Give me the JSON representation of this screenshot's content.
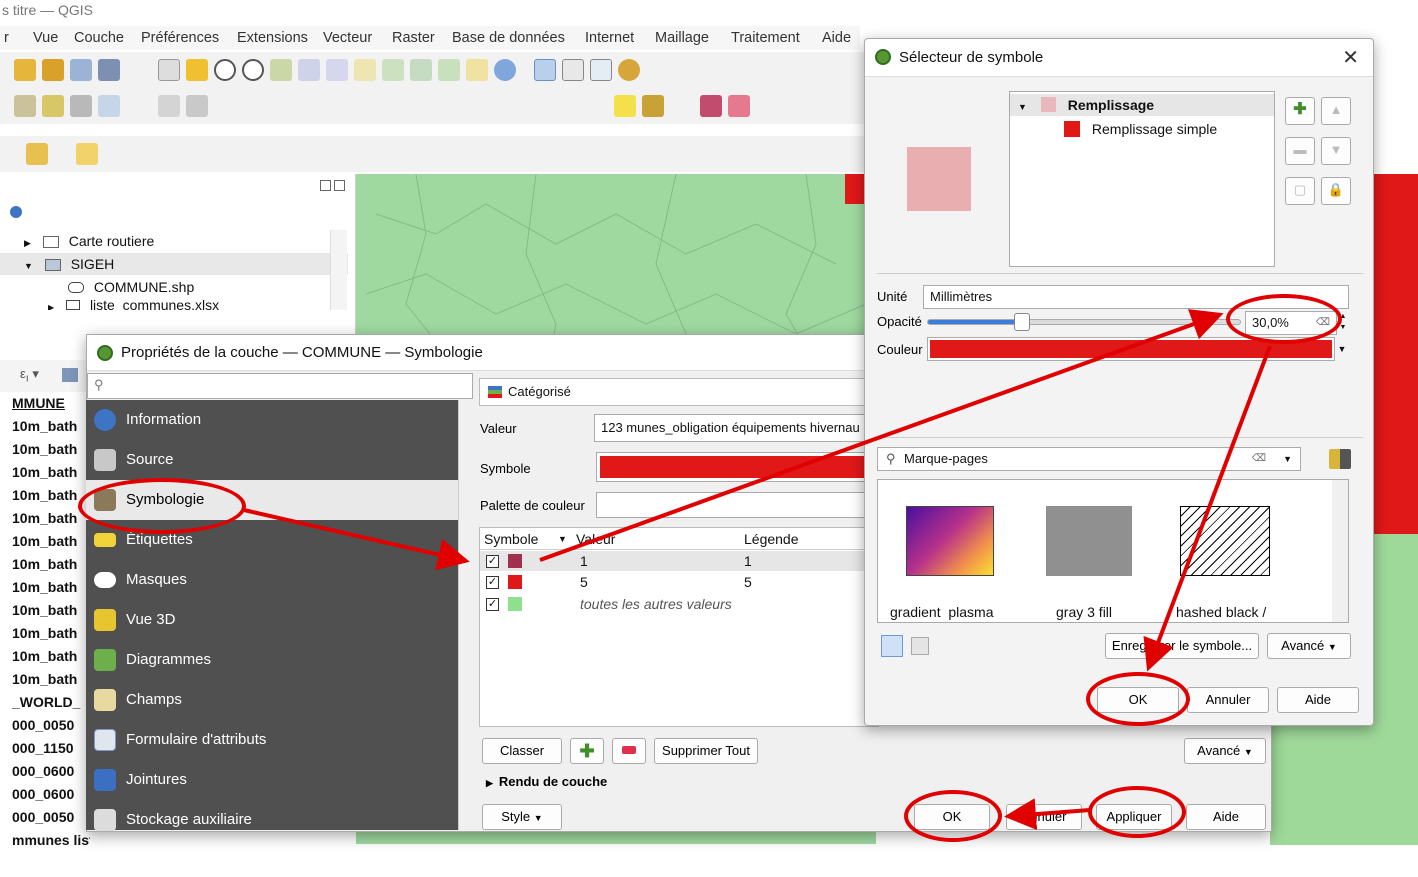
{
  "window_title": "s titre — QGIS",
  "menu": [
    "r",
    "Vue",
    "Couche",
    "Préférences",
    "Extensions",
    "Vecteur",
    "Raster",
    "Base de données",
    "Internet",
    "Maillage",
    "Traitement",
    "Aide"
  ],
  "layers_panel": {
    "items": [
      "Carte routiere",
      "SIGEH",
      "COMMUNE.shp",
      "liste_communes.xlsx"
    ]
  },
  "left_list": [
    "MMUNE",
    "10m_bath",
    "10m_bath",
    "10m_bath",
    "10m_bath",
    "10m_bath",
    "10m_bath",
    "10m_bath",
    "10m_bath",
    "10m_bath",
    "10m_bath",
    "10m_bath",
    "10m_bath",
    "_WORLD_",
    "000_0050",
    "000_1150",
    "000_0600",
    "000_0600",
    "000_0050",
    "mmunes liste communes"
  ],
  "props": {
    "title": "Propriétés de la couche — COMMUNE — Symbologie",
    "search_placeholder": "",
    "sidebar": [
      "Information",
      "Source",
      "Symbologie",
      "Étiquettes",
      "Masques",
      "Vue 3D",
      "Diagrammes",
      "Champs",
      "Formulaire d'attributs",
      "Jointures",
      "Stockage auxiliaire"
    ],
    "renderer": "Catégorisé",
    "value_label": "Valeur",
    "value_field": "123 munes_obligation équipements hivernau",
    "symbol_label": "Symbole",
    "palette_label": "Palette de couleur",
    "columns": [
      "Symbole",
      "Valeur",
      "Légende"
    ],
    "rows": [
      {
        "value": "1",
        "legend": "1",
        "color": "#a0304c"
      },
      {
        "value": "5",
        "legend": "5",
        "color": "#e01818"
      },
      {
        "value": "toutes les autres valeurs",
        "legend": "",
        "color": "#8ee08e"
      }
    ],
    "classify_btn": "Classer",
    "delete_all_btn": "Supprimer Tout",
    "advanced_btn": "Avancé",
    "layer_render": "Rendu de couche",
    "style_btn": "Style",
    "ok_btn": "OK",
    "cancel_btn": "Annuler",
    "apply_btn": "Appliquer",
    "help_btn": "Aide"
  },
  "selector": {
    "title": "Sélecteur de symbole",
    "tree_root": "Remplissage",
    "tree_child": "Remplissage simple",
    "unit_label": "Unité",
    "unit_value": "Millimètres",
    "opacity_label": "Opacité",
    "opacity_value": "30,0%",
    "opacity_level": 0.3,
    "color_label": "Couleur",
    "search_value": "Marque-pages",
    "swatches": [
      "gradient  plasma",
      "gray 3 fill",
      "hashed black /"
    ],
    "save_btn": "Enregistrer le symbole...",
    "advanced_btn": "Avancé",
    "ok_btn": "OK",
    "cancel_btn": "Annuler",
    "help_btn": "Aide"
  },
  "colors": {
    "accent_red": "#e01818",
    "annotation": "#e00000",
    "preview": "#e8aeb0",
    "sidebar": "#505050"
  }
}
